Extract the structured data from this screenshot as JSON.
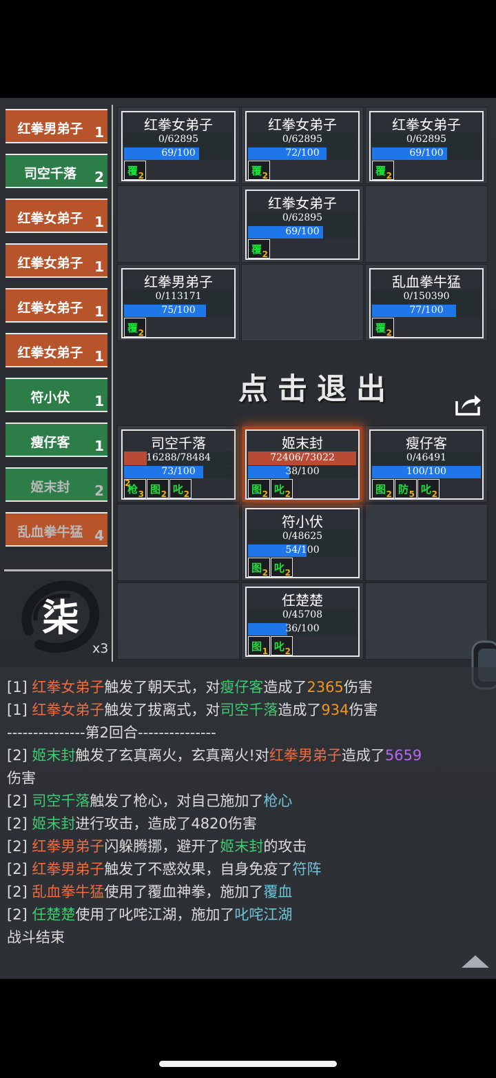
{
  "turn_order": [
    {
      "name": "红拳男弟子",
      "count": "1",
      "side": "enemy"
    },
    {
      "name": "司空千落",
      "count": "2",
      "side": "ally"
    },
    {
      "name": "红拳女弟子",
      "count": "1",
      "side": "enemy"
    },
    {
      "name": "红拳女弟子",
      "count": "1",
      "side": "enemy"
    },
    {
      "name": "红拳女弟子",
      "count": "1",
      "side": "enemy"
    },
    {
      "name": "红拳女弟子",
      "count": "1",
      "side": "enemy"
    },
    {
      "name": "符小伏",
      "count": "1",
      "side": "ally"
    },
    {
      "name": "瘦仔客",
      "count": "1",
      "side": "ally"
    },
    {
      "name": "姬末封",
      "count": "2",
      "side": "ally"
    },
    {
      "name": "乱血拳牛猛",
      "count": "4",
      "side": "enemy"
    }
  ],
  "round": {
    "char": "柒",
    "speed": "x3"
  },
  "exit_label": "点击退出",
  "enemies": [
    {
      "name": "红拳女弟子",
      "hp": "0/62895",
      "hp_pct": 0,
      "rage": "69/100",
      "rage_pct": 69,
      "statuses": [
        {
          "name": "覆",
          "count": "2"
        }
      ]
    },
    {
      "name": "红拳女弟子",
      "hp": "0/62895",
      "hp_pct": 0,
      "rage": "72/100",
      "rage_pct": 72,
      "statuses": [
        {
          "name": "覆",
          "count": "2"
        }
      ]
    },
    {
      "name": "红拳女弟子",
      "hp": "0/62895",
      "hp_pct": 0,
      "rage": "69/100",
      "rage_pct": 69,
      "statuses": [
        {
          "name": "覆",
          "count": "2"
        }
      ]
    },
    {
      "name": "红拳女弟子",
      "hp": "0/62895",
      "hp_pct": 0,
      "rage": "69/100",
      "rage_pct": 69,
      "statuses": [
        {
          "name": "覆",
          "count": "2"
        }
      ]
    },
    {
      "name": "红拳男弟子",
      "hp": "0/113171",
      "hp_pct": 0,
      "rage": "75/100",
      "rage_pct": 75,
      "statuses": [
        {
          "name": "覆",
          "count": "2"
        }
      ]
    },
    {
      "name": "乱血拳牛猛",
      "hp": "0/150390",
      "hp_pct": 0,
      "rage": "77/100",
      "rage_pct": 77,
      "statuses": [
        {
          "name": "覆",
          "count": "2"
        }
      ]
    }
  ],
  "allies": [
    {
      "name": "司空千落",
      "hp": "16288/78484",
      "hp_pct": 20.8,
      "rage": "73/100",
      "rage_pct": 73,
      "statuses": [
        {
          "pre": "2",
          "name": "枪",
          "count": "3"
        },
        {
          "name": "图",
          "count": "2"
        },
        {
          "name": "叱",
          "count": "2"
        }
      ]
    },
    {
      "name": "姬末封",
      "hp": "72406/73022",
      "hp_pct": 99.2,
      "rage": "38/100",
      "rage_pct": 38,
      "active": true,
      "statuses": [
        {
          "name": "图",
          "count": "2"
        },
        {
          "name": "叱",
          "count": "2"
        }
      ]
    },
    {
      "name": "瘦仔客",
      "hp": "0/46491",
      "hp_pct": 0,
      "rage": "100/100",
      "rage_pct": 100,
      "statuses": [
        {
          "name": "图",
          "count": "2"
        },
        {
          "name": "防",
          "count": "5"
        },
        {
          "name": "叱",
          "count": "2"
        }
      ]
    },
    {
      "name": "符小伏",
      "hp": "0/48625",
      "hp_pct": 0,
      "rage": "54/100",
      "rage_pct": 54,
      "statuses": [
        {
          "name": "图",
          "count": "2"
        },
        {
          "name": "叱",
          "count": "2"
        }
      ]
    },
    {
      "name": "任楚楚",
      "hp": "0/45708",
      "hp_pct": 0,
      "rage": "36/100",
      "rage_pct": 36,
      "statuses": [
        {
          "name": "图",
          "count": "1"
        },
        {
          "name": "叱",
          "count": "2"
        }
      ]
    }
  ],
  "log": [
    [
      {
        "t": "[1] "
      },
      {
        "t": "红拳女弟子",
        "c": "red"
      },
      {
        "t": "触发了朝天式，对"
      },
      {
        "t": "瘦仔客",
        "c": "green"
      },
      {
        "t": "造成了"
      },
      {
        "t": "2365",
        "c": "orange"
      },
      {
        "t": "伤害"
      }
    ],
    [
      {
        "t": "[1] "
      },
      {
        "t": "红拳女弟子",
        "c": "red"
      },
      {
        "t": "触发了拔离式，对"
      },
      {
        "t": "司空千落",
        "c": "green"
      },
      {
        "t": "造成了"
      },
      {
        "t": "934",
        "c": "orange"
      },
      {
        "t": "伤害"
      }
    ],
    [
      {
        "t": "---------------第2回合---------------"
      }
    ],
    [
      {
        "t": "[2] "
      },
      {
        "t": "姬末封",
        "c": "green"
      },
      {
        "t": "触发了玄真离火，玄真离火!对"
      },
      {
        "t": "红拳男弟子",
        "c": "red"
      },
      {
        "t": "造成了"
      },
      {
        "t": "5659",
        "c": "purple"
      }
    ],
    [
      {
        "t": "伤害"
      }
    ],
    [
      {
        "t": "[2] "
      },
      {
        "t": "司空千落",
        "c": "green"
      },
      {
        "t": "触发了枪心，对自己施加了"
      },
      {
        "t": "枪心",
        "c": "blue"
      }
    ],
    [
      {
        "t": "[2] "
      },
      {
        "t": "姬末封",
        "c": "green"
      },
      {
        "t": "进行攻击，造成了4820伤害"
      }
    ],
    [
      {
        "t": "[2] "
      },
      {
        "t": "红拳男弟子",
        "c": "red"
      },
      {
        "t": "闪躲腾挪，避开了"
      },
      {
        "t": "姬末封",
        "c": "green"
      },
      {
        "t": "的攻击"
      }
    ],
    [
      {
        "t": "[2] "
      },
      {
        "t": "红拳男弟子",
        "c": "red"
      },
      {
        "t": "触发了不惑效果，自身免疫了"
      },
      {
        "t": "符阵",
        "c": "blue"
      }
    ],
    [
      {
        "t": "[2] "
      },
      {
        "t": "乱血拳牛猛",
        "c": "red"
      },
      {
        "t": "使用了覆血神拳，施加了"
      },
      {
        "t": "覆血",
        "c": "blue"
      }
    ],
    [
      {
        "t": "[2] "
      },
      {
        "t": "任楚楚",
        "c": "green"
      },
      {
        "t": "使用了叱咤江湖，施加了"
      },
      {
        "t": "叱咤江湖",
        "c": "blue"
      }
    ],
    [
      {
        "t": "战斗结束"
      }
    ]
  ],
  "colors": {
    "enemy": "#b8542c",
    "ally": "#2d7d49",
    "hp": "#b94a36",
    "rage": "#1e76e8",
    "status_name": "#19e23b",
    "status_count": "#e8b019"
  },
  "icons": {
    "share": "share-icon",
    "scroll": "scroll-up-icon"
  }
}
